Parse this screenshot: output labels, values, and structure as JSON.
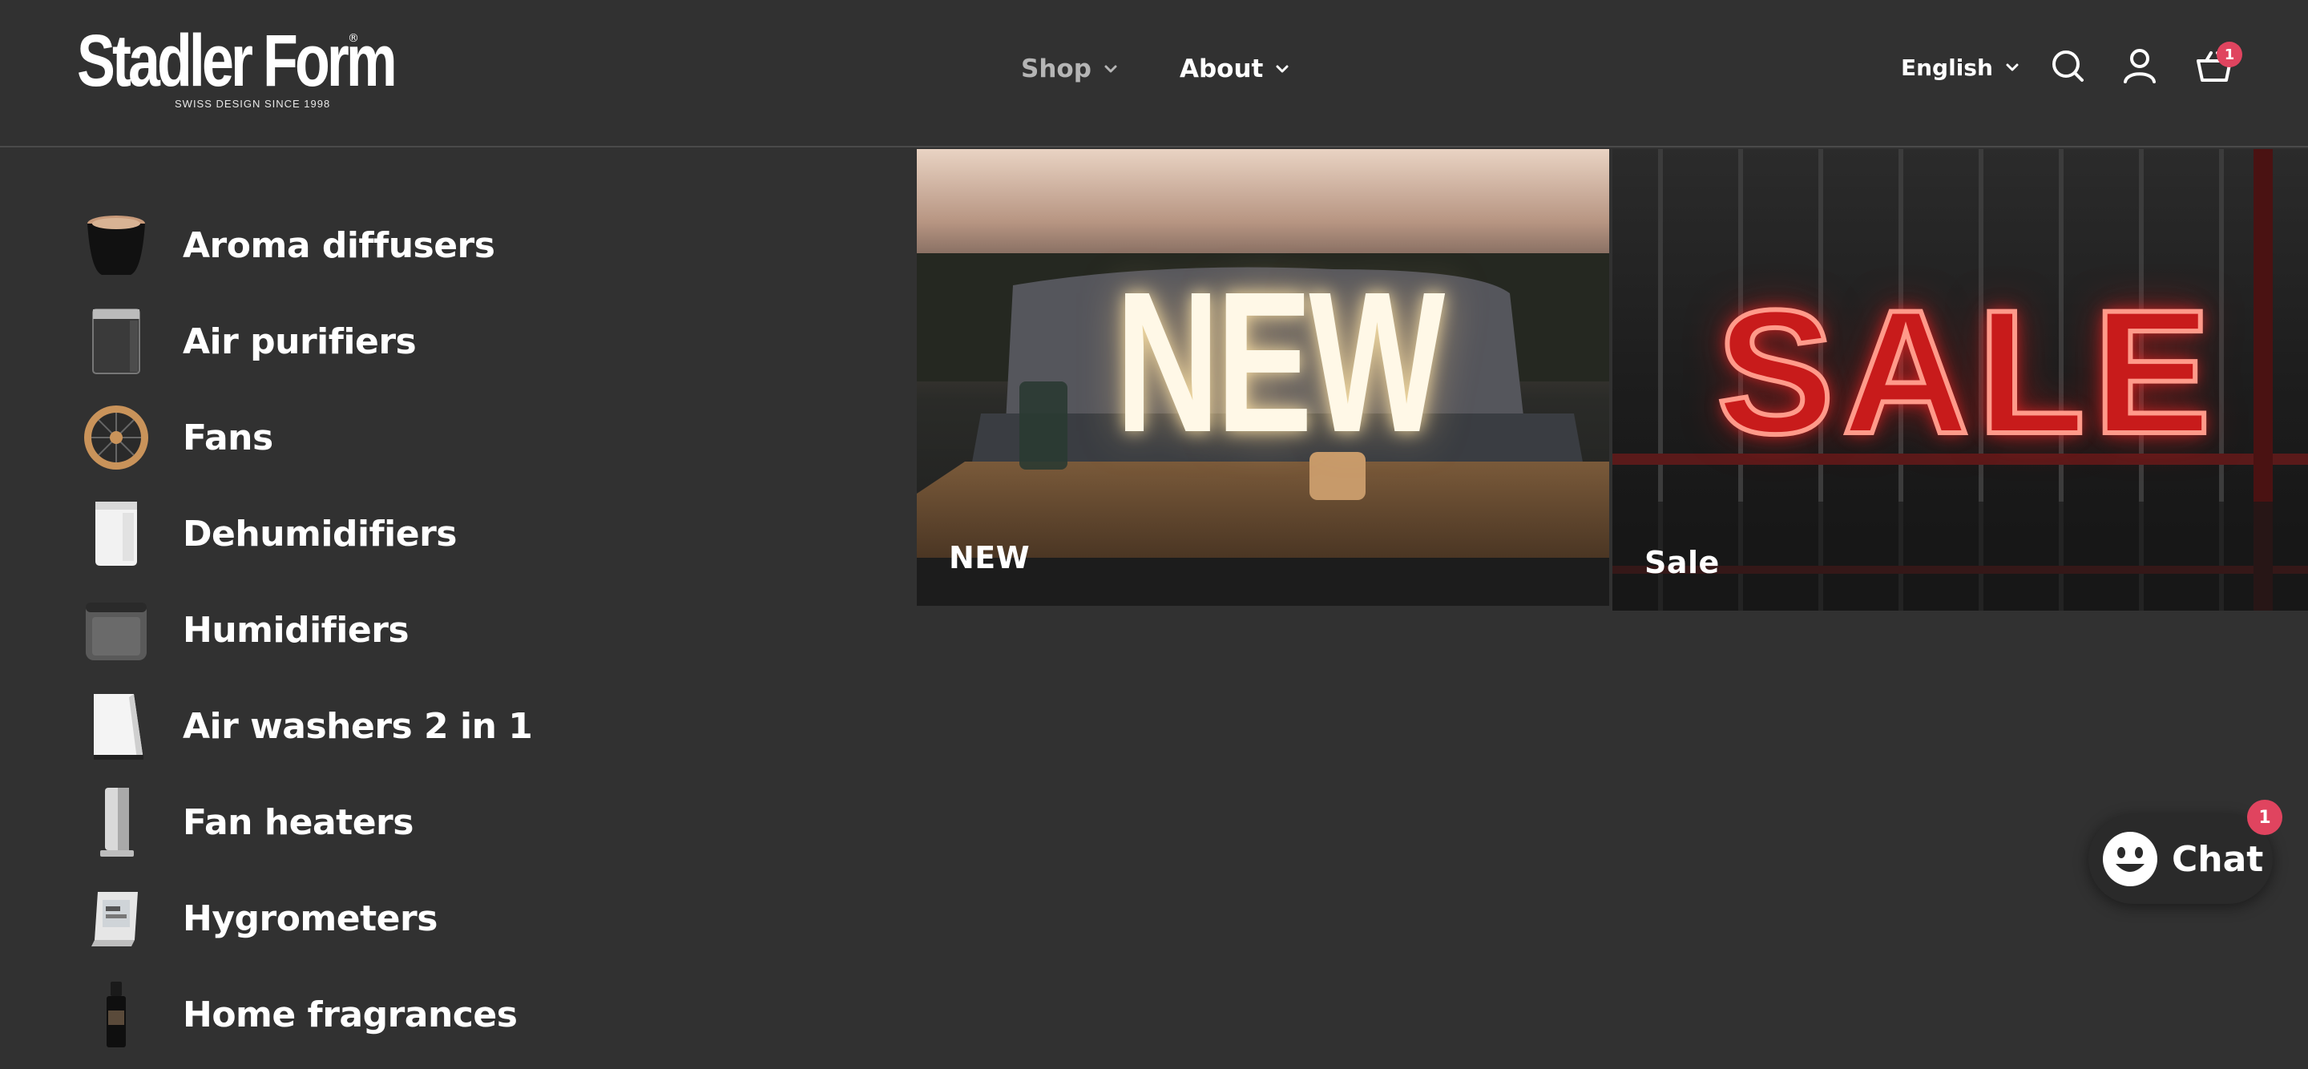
{
  "brand": {
    "name": "Stadler Form",
    "tagline": "SWISS DESIGN SINCE 1998",
    "registered": "®"
  },
  "nav": {
    "shop": "Shop",
    "about": "About"
  },
  "header": {
    "language": "English",
    "cart_count": "1"
  },
  "menu": {
    "items": [
      {
        "label": "Aroma diffusers",
        "icon": "aroma-diffuser-icon"
      },
      {
        "label": "Air purifiers",
        "icon": "air-purifier-icon"
      },
      {
        "label": "Fans",
        "icon": "fan-icon"
      },
      {
        "label": "Dehumidifiers",
        "icon": "dehumidifier-icon"
      },
      {
        "label": "Humidifiers",
        "icon": "humidifier-icon"
      },
      {
        "label": "Air washers 2 in 1",
        "icon": "air-washer-icon"
      },
      {
        "label": "Fan heaters",
        "icon": "fan-heater-icon"
      },
      {
        "label": "Hygrometers",
        "icon": "hygrometer-icon"
      },
      {
        "label": "Home fragrances",
        "icon": "home-fragrance-icon"
      }
    ]
  },
  "promos": {
    "new": {
      "big_text": "NEW",
      "caption": "NEW"
    },
    "sale": {
      "big_text": "SALE",
      "caption": "Sale"
    }
  },
  "chat": {
    "label": "Chat",
    "badge": "1"
  },
  "colors": {
    "background": "#313131",
    "badge": "#e0445f",
    "nav_dim": "#b5b5b5"
  }
}
